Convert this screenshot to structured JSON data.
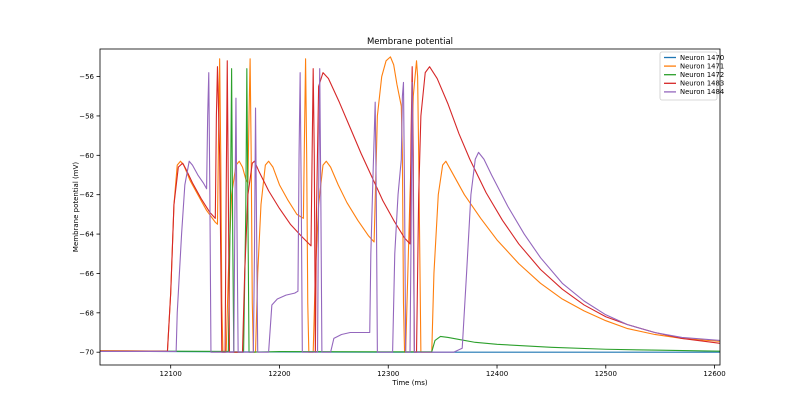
{
  "chart_data": {
    "type": "line",
    "title": "Membrane potential",
    "xlabel": "Time (ms)",
    "ylabel": "Membrane potential (mV)",
    "xlim": [
      12035,
      12605
    ],
    "ylim": [
      -70.65,
      -54.6
    ],
    "xticks": [
      12100,
      12200,
      12300,
      12400,
      12500,
      12600
    ],
    "yticks": [
      -70,
      -68,
      -66,
      -64,
      -62,
      -60,
      -58,
      -56
    ],
    "grid": false,
    "legend_position": "top-right",
    "series": [
      {
        "name": "Neuron 1470",
        "color": "#1f77b4",
        "points": [
          [
            12035,
            -69.95
          ],
          [
            12100,
            -69.97
          ],
          [
            12200,
            -69.99
          ],
          [
            12300,
            -70.0
          ],
          [
            12400,
            -70.0
          ],
          [
            12500,
            -70.0
          ],
          [
            12605,
            -70.0
          ]
        ]
      },
      {
        "name": "Neuron 1471",
        "color": "#ff7f0e",
        "points": [
          [
            12035,
            -69.92
          ],
          [
            12060,
            -69.93
          ],
          [
            12090,
            -69.95
          ],
          [
            12097,
            -69.95
          ],
          [
            12100,
            -67.0
          ],
          [
            12103,
            -62.5
          ],
          [
            12106,
            -60.5
          ],
          [
            12109,
            -60.3
          ],
          [
            12112,
            -60.5
          ],
          [
            12118,
            -61.3
          ],
          [
            12125,
            -62.0
          ],
          [
            12133,
            -62.8
          ],
          [
            12141,
            -63.4
          ],
          [
            12143,
            -63.5
          ],
          [
            12144,
            -59.0
          ],
          [
            12145,
            -55.1
          ],
          [
            12146,
            -60.0
          ],
          [
            12147,
            -67.5
          ],
          [
            12148,
            -70.0
          ],
          [
            12151,
            -70.0
          ],
          [
            12153,
            -66.0
          ],
          [
            12156,
            -62.0
          ],
          [
            12160,
            -60.5
          ],
          [
            12163,
            -60.3
          ],
          [
            12166,
            -60.6
          ],
          [
            12169,
            -61.2
          ],
          [
            12171,
            -61.4
          ],
          [
            12172,
            -58.0
          ],
          [
            12173,
            -55.1
          ],
          [
            12174,
            -60.0
          ],
          [
            12175,
            -67.5
          ],
          [
            12176,
            -70.0
          ],
          [
            12178,
            -70.0
          ],
          [
            12180,
            -66.0
          ],
          [
            12183,
            -62.5
          ],
          [
            12187,
            -60.5
          ],
          [
            12190,
            -60.3
          ],
          [
            12194,
            -60.6
          ],
          [
            12200,
            -61.5
          ],
          [
            12208,
            -62.3
          ],
          [
            12216,
            -63.0
          ],
          [
            12222,
            -63.2
          ],
          [
            12223,
            -59.0
          ],
          [
            12224,
            -55.1
          ],
          [
            12225,
            -60.0
          ],
          [
            12226,
            -67.5
          ],
          [
            12227,
            -70.0
          ],
          [
            12231,
            -70.0
          ],
          [
            12233,
            -66.0
          ],
          [
            12236,
            -62.5
          ],
          [
            12240,
            -60.5
          ],
          [
            12243,
            -60.3
          ],
          [
            12247,
            -60.6
          ],
          [
            12254,
            -61.5
          ],
          [
            12262,
            -62.4
          ],
          [
            12272,
            -63.3
          ],
          [
            12282,
            -64.1
          ],
          [
            12287,
            -64.4
          ],
          [
            12290,
            -58.0
          ],
          [
            12294,
            -56.0
          ],
          [
            12298,
            -55.2
          ],
          [
            12302,
            -55.0
          ],
          [
            12305,
            -55.4
          ],
          [
            12308,
            -56.4
          ],
          [
            12312,
            -57.5
          ],
          [
            12313,
            -60.0
          ],
          [
            12314,
            -67.5
          ],
          [
            12315,
            -70.0
          ],
          [
            12316,
            -70.0
          ],
          [
            12318,
            -66.0
          ],
          [
            12320,
            -62.0
          ],
          [
            12323,
            -57.0
          ],
          [
            12326,
            -55.2
          ],
          [
            12327,
            -56.0
          ],
          [
            12328,
            -60.0
          ],
          [
            12330,
            -70.0
          ],
          [
            12340,
            -70.0
          ],
          [
            12342,
            -66.0
          ],
          [
            12346,
            -62.0
          ],
          [
            12350,
            -60.5
          ],
          [
            12353,
            -60.3
          ],
          [
            12358,
            -60.8
          ],
          [
            12370,
            -62.0
          ],
          [
            12385,
            -63.2
          ],
          [
            12400,
            -64.3
          ],
          [
            12420,
            -65.5
          ],
          [
            12440,
            -66.5
          ],
          [
            12460,
            -67.3
          ],
          [
            12480,
            -67.9
          ],
          [
            12500,
            -68.4
          ],
          [
            12520,
            -68.8
          ],
          [
            12545,
            -69.1
          ],
          [
            12570,
            -69.3
          ],
          [
            12605,
            -69.45
          ]
        ]
      },
      {
        "name": "Neuron 1472",
        "color": "#2ca02c",
        "points": [
          [
            12035,
            -69.95
          ],
          [
            12100,
            -69.95
          ],
          [
            12150,
            -69.96
          ],
          [
            12153,
            -69.96
          ],
          [
            12155,
            -62.0
          ],
          [
            12156,
            -55.6
          ],
          [
            12157,
            -64.0
          ],
          [
            12158,
            -70.0
          ],
          [
            12167,
            -70.0
          ],
          [
            12169,
            -63.0
          ],
          [
            12170,
            -55.6
          ],
          [
            12171,
            -63.0
          ],
          [
            12172,
            -70.0
          ],
          [
            12173,
            -70.0
          ],
          [
            12200,
            -69.97
          ],
          [
            12300,
            -69.98
          ],
          [
            12340,
            -69.98
          ],
          [
            12343,
            -69.4
          ],
          [
            12348,
            -69.2
          ],
          [
            12355,
            -69.25
          ],
          [
            12365,
            -69.35
          ],
          [
            12380,
            -69.5
          ],
          [
            12400,
            -69.6
          ],
          [
            12450,
            -69.75
          ],
          [
            12500,
            -69.85
          ],
          [
            12550,
            -69.9
          ],
          [
            12605,
            -69.95
          ]
        ]
      },
      {
        "name": "Neuron 1483",
        "color": "#d62728",
        "points": [
          [
            12035,
            -69.95
          ],
          [
            12097,
            -69.95
          ],
          [
            12100,
            -67.0
          ],
          [
            12103,
            -62.5
          ],
          [
            12107,
            -60.6
          ],
          [
            12111,
            -60.4
          ],
          [
            12114,
            -60.7
          ],
          [
            12120,
            -61.4
          ],
          [
            12128,
            -62.2
          ],
          [
            12136,
            -62.9
          ],
          [
            12141,
            -63.2
          ],
          [
            12142,
            -58.0
          ],
          [
            12143,
            -55.5
          ],
          [
            12145,
            -60.0
          ],
          [
            12147,
            -70.0
          ],
          [
            12150,
            -70.0
          ],
          [
            12151,
            -62.0
          ],
          [
            12152,
            -55.2
          ],
          [
            12153,
            -62.0
          ],
          [
            12154,
            -70.0
          ],
          [
            12166,
            -70.0
          ],
          [
            12168,
            -66.0
          ],
          [
            12171,
            -62.0
          ],
          [
            12175,
            -60.4
          ],
          [
            12177,
            -60.3
          ],
          [
            12181,
            -60.8
          ],
          [
            12190,
            -61.8
          ],
          [
            12200,
            -62.7
          ],
          [
            12210,
            -63.5
          ],
          [
            12220,
            -64.1
          ],
          [
            12229,
            -64.6
          ],
          [
            12230,
            -60.0
          ],
          [
            12231,
            -55.6
          ],
          [
            12232,
            -60.0
          ],
          [
            12233,
            -70.0
          ],
          [
            12234,
            -63.0
          ],
          [
            12236,
            -56.5
          ],
          [
            12240,
            -55.8
          ],
          [
            12245,
            -56.1
          ],
          [
            12255,
            -57.3
          ],
          [
            12265,
            -58.6
          ],
          [
            12275,
            -59.9
          ],
          [
            12285,
            -61.1
          ],
          [
            12295,
            -62.3
          ],
          [
            12305,
            -63.3
          ],
          [
            12315,
            -64.2
          ],
          [
            12320,
            -64.5
          ],
          [
            12321,
            -59.0
          ],
          [
            12322,
            -55.5
          ],
          [
            12323,
            -60.0
          ],
          [
            12324,
            -70.0
          ],
          [
            12326,
            -70.0
          ],
          [
            12328,
            -62.0
          ],
          [
            12330,
            -58.0
          ],
          [
            12334,
            -55.8
          ],
          [
            12338,
            -55.5
          ],
          [
            12345,
            -56.1
          ],
          [
            12355,
            -57.4
          ],
          [
            12365,
            -58.9
          ],
          [
            12375,
            -60.2
          ],
          [
            12390,
            -61.9
          ],
          [
            12405,
            -63.3
          ],
          [
            12420,
            -64.5
          ],
          [
            12440,
            -65.8
          ],
          [
            12460,
            -66.8
          ],
          [
            12480,
            -67.6
          ],
          [
            12500,
            -68.2
          ],
          [
            12520,
            -68.6
          ],
          [
            12545,
            -69.0
          ],
          [
            12570,
            -69.3
          ],
          [
            12605,
            -69.55
          ]
        ]
      },
      {
        "name": "Neuron 1484",
        "color": "#9467bd",
        "points": [
          [
            12035,
            -69.96
          ],
          [
            12105,
            -69.96
          ],
          [
            12106,
            -68.0
          ],
          [
            12110,
            -64.0
          ],
          [
            12113,
            -61.5
          ],
          [
            12117,
            -60.3
          ],
          [
            12120,
            -60.5
          ],
          [
            12125,
            -61.0
          ],
          [
            12130,
            -61.4
          ],
          [
            12133,
            -61.7
          ],
          [
            12134,
            -58.0
          ],
          [
            12135,
            -55.8
          ],
          [
            12136,
            -62.0
          ],
          [
            12137,
            -70.0
          ],
          [
            12158,
            -70.0
          ],
          [
            12159,
            -63.0
          ],
          [
            12160,
            -57.1
          ],
          [
            12161,
            -64.0
          ],
          [
            12162,
            -70.0
          ],
          [
            12176,
            -70.0
          ],
          [
            12177,
            -65.0
          ],
          [
            12178,
            -57.6
          ],
          [
            12179,
            -64.0
          ],
          [
            12180,
            -70.0
          ],
          [
            12190,
            -70.0
          ],
          [
            12193,
            -67.6
          ],
          [
            12198,
            -67.3
          ],
          [
            12206,
            -67.1
          ],
          [
            12214,
            -67.0
          ],
          [
            12217,
            -66.9
          ],
          [
            12218,
            -60.0
          ],
          [
            12219,
            -55.8
          ],
          [
            12220,
            -62.0
          ],
          [
            12221,
            -70.0
          ],
          [
            12235,
            -70.0
          ],
          [
            12236,
            -62.0
          ],
          [
            12237,
            -55.6
          ],
          [
            12238,
            -62.0
          ],
          [
            12239,
            -70.0
          ],
          [
            12247,
            -70.0
          ],
          [
            12250,
            -69.3
          ],
          [
            12257,
            -69.1
          ],
          [
            12265,
            -69.0
          ],
          [
            12272,
            -69.0
          ],
          [
            12283,
            -69.0
          ],
          [
            12284,
            -65.0
          ],
          [
            12286,
            -61.0
          ],
          [
            12288,
            -57.3
          ],
          [
            12289,
            -62.0
          ],
          [
            12290,
            -70.0
          ],
          [
            12304,
            -70.0
          ],
          [
            12306,
            -65.0
          ],
          [
            12309,
            -62.0
          ],
          [
            12312,
            -60.2
          ],
          [
            12313,
            -57.0
          ],
          [
            12314,
            -56.3
          ],
          [
            12315,
            -62.0
          ],
          [
            12316,
            -70.0
          ],
          [
            12320,
            -70.0
          ],
          [
            12321,
            -64.0
          ],
          [
            12322,
            -56.3
          ],
          [
            12323,
            -63.0
          ],
          [
            12324,
            -70.0
          ],
          [
            12330,
            -70.0
          ],
          [
            12345,
            -70.0
          ],
          [
            12360,
            -70.0
          ],
          [
            12368,
            -69.8
          ],
          [
            12372,
            -66.0
          ],
          [
            12376,
            -62.0
          ],
          [
            12380,
            -60.2
          ],
          [
            12383,
            -59.85
          ],
          [
            12388,
            -60.2
          ],
          [
            12395,
            -61.0
          ],
          [
            12410,
            -62.6
          ],
          [
            12425,
            -64.0
          ],
          [
            12440,
            -65.2
          ],
          [
            12460,
            -66.5
          ],
          [
            12480,
            -67.4
          ],
          [
            12500,
            -68.1
          ],
          [
            12520,
            -68.6
          ],
          [
            12545,
            -69.0
          ],
          [
            12570,
            -69.25
          ],
          [
            12605,
            -69.4
          ]
        ]
      }
    ]
  }
}
